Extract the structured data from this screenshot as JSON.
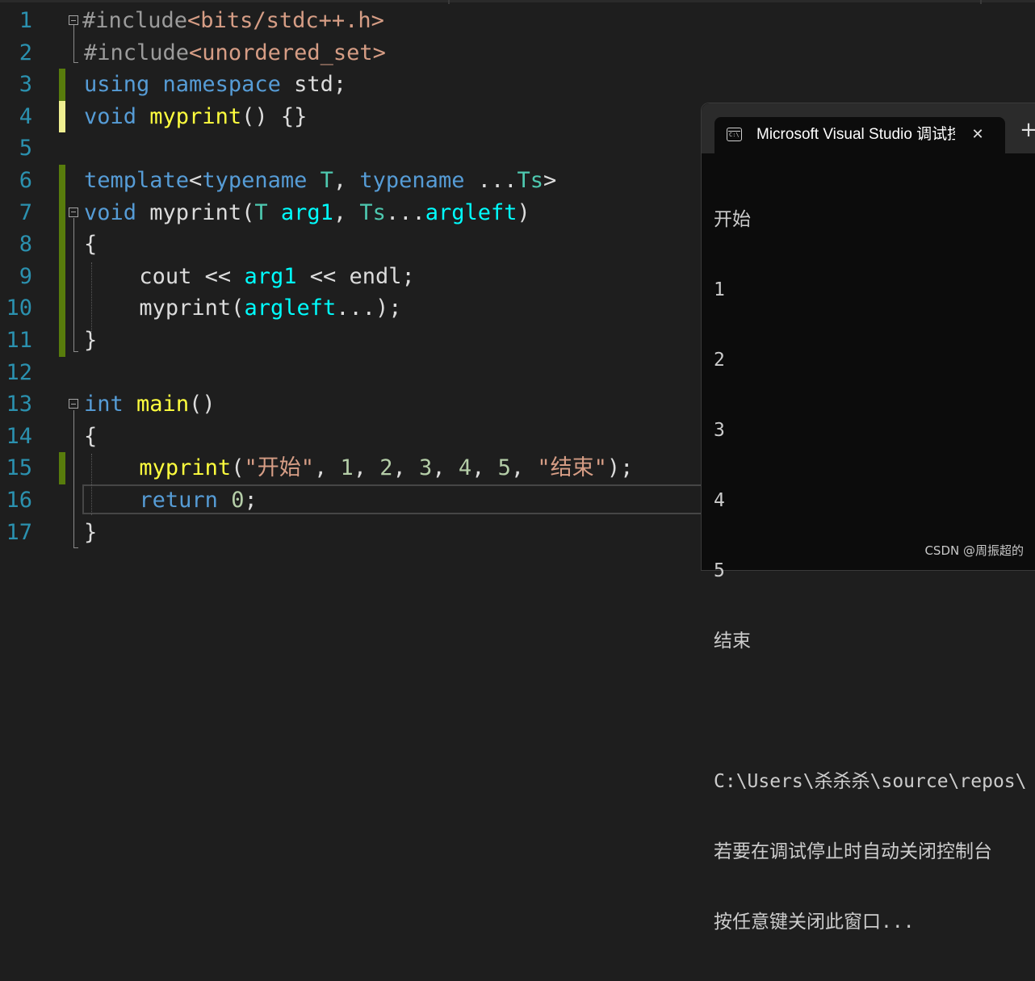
{
  "editor": {
    "line_numbers": [
      "1",
      "2",
      "3",
      "4",
      "5",
      "6",
      "7",
      "8",
      "9",
      "10",
      "11",
      "12",
      "13",
      "14",
      "15",
      "16",
      "17"
    ],
    "l1": {
      "a": "#include",
      "b": "<bits/stdc++.h>"
    },
    "l2": {
      "a": "#include",
      "b": "<unordered_set>"
    },
    "l3": {
      "a": "using",
      "b": " ",
      "c": "namespace",
      "d": " std;"
    },
    "l4": {
      "a": "void",
      "b": " ",
      "c": "myprint",
      "d": "() {}"
    },
    "l6": {
      "a": "template",
      "b": "<",
      "c": "typename",
      "d": " ",
      "e": "T",
      "f": ", ",
      "g": "typename",
      "h": " ...",
      "i": "Ts",
      "j": ">"
    },
    "l7": {
      "a": "void",
      "b": " myprint(",
      "c": "T",
      "d": " ",
      "e": "arg1",
      "f": ", ",
      "g": "Ts",
      "h": "...",
      "i": "argleft",
      "j": ")"
    },
    "l8": {
      "a": "{"
    },
    "l9": {
      "a": "cout << ",
      "b": "arg1",
      "c": " << endl;"
    },
    "l10": {
      "a": "myprint(",
      "b": "argleft",
      "c": "...);"
    },
    "l11": {
      "a": "}"
    },
    "l13": {
      "a": "int",
      "b": " ",
      "c": "main",
      "d": "()"
    },
    "l14": {
      "a": "{"
    },
    "l15": {
      "a": "myprint",
      "b": "(",
      "c": "\"开始\"",
      "d": ", ",
      "e": "1",
      "f": ", ",
      "g": "2",
      "h": ", ",
      "i": "3",
      "j": ", ",
      "k": "4",
      "l": ", ",
      "m": "5",
      "n": ", ",
      "o": "\"结束\"",
      "p": ");"
    },
    "l16": {
      "a": "return",
      "b": " ",
      "c": "0",
      "d": ";"
    },
    "l17": {
      "a": "}"
    }
  },
  "console": {
    "tab_title": "Microsoft Visual Studio 调试控制台",
    "close_glyph": "✕",
    "add_glyph": "+",
    "output": [
      "开始",
      "1",
      "2",
      "3",
      "4",
      "5",
      "结束",
      "",
      "C:\\Users\\杀杀杀\\source\\repos\\",
      "若要在调试停止时自动关闭控制台",
      "按任意键关闭此窗口..."
    ]
  },
  "watermark": "CSDN @周振超的",
  "colors": {
    "background": "#1e1e1e",
    "line_number": "#2b91af",
    "keyword": "#569cd6",
    "function": "#dcdcaa",
    "string": "#d69d85",
    "number": "#b5cea8",
    "type": "#4ec9b0",
    "parameter": "#00ffff",
    "change_saved": "#587c0c",
    "change_unsaved": "#efef91",
    "console_bg": "#0c0c0c"
  }
}
